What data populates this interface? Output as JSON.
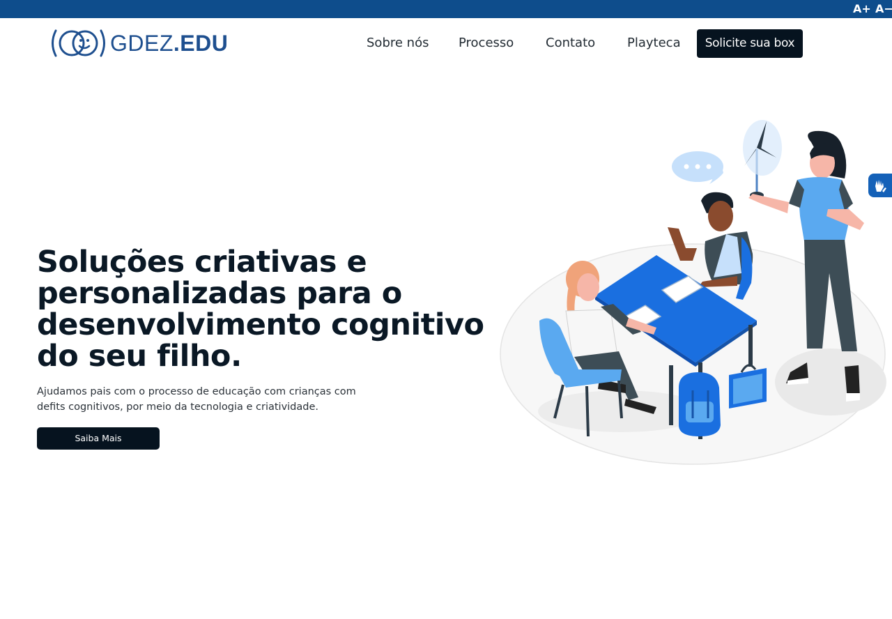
{
  "top_bar": {
    "increase_font_label": "A+",
    "decrease_font_label": "A−",
    "color": "#0e4d8c"
  },
  "header": {
    "logo": {
      "text_plain": "GDEZ",
      "text_bold": ".EDU",
      "color": "#1e4f8f"
    },
    "nav": [
      {
        "label": "Sobre nós"
      },
      {
        "label": "Processo"
      },
      {
        "label": "Contato"
      },
      {
        "label": "Playteca"
      }
    ],
    "cta_label": "Solicite sua box"
  },
  "hero": {
    "title": "Soluções criativas e personalizadas para o desenvolvimento cognitivo do seu filho.",
    "subtitle": "Ajudamos pais com o processo de educação com crianças com defits cognitivos, por meio da tecnologia e criatividade.",
    "button_label": "Saiba Mais",
    "illustration_icon": "children-classroom-illustration"
  },
  "accessibility_widget": {
    "icon": "sign-language-hands-icon",
    "color": "#1461b8"
  },
  "colors": {
    "dark_button": "#06131f",
    "accent_blue": "#1a6fe0",
    "light_blue": "#5aa9f0"
  }
}
